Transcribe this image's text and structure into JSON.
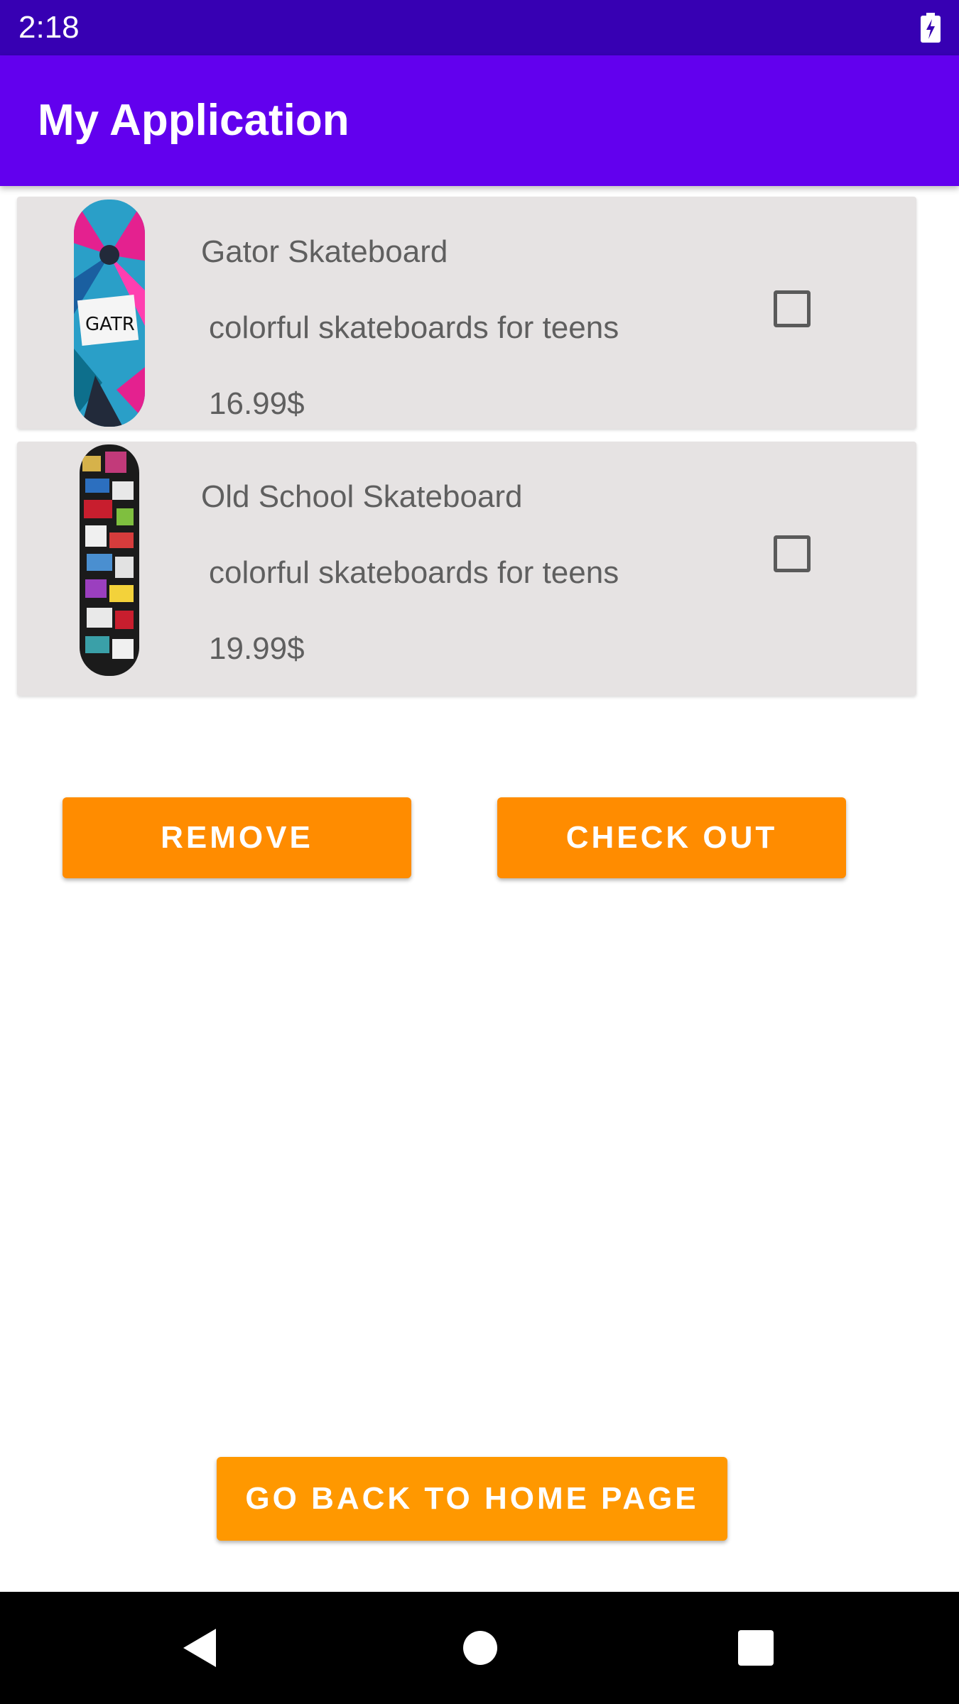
{
  "status_bar": {
    "time": "2:18",
    "battery_icon": "battery-charging-icon"
  },
  "app_bar": {
    "title": "My Application"
  },
  "cart": {
    "items": [
      {
        "name": "Gator Skateboard",
        "description": "colorful skateboards for teens",
        "price": "16.99$",
        "checked": false,
        "image": "gator-skateboard-image"
      },
      {
        "name": "Old School Skateboard",
        "description": "colorful skateboards for teens",
        "price": "19.99$",
        "checked": false,
        "image": "old-school-skateboard-image"
      }
    ]
  },
  "actions": {
    "remove_label": "REMOVE",
    "checkout_label": "CHECK OUT",
    "home_label": "GO BACK TO HOME PAGE"
  },
  "nav_bar": {
    "icons": [
      "back-icon",
      "home-icon",
      "recents-icon"
    ]
  },
  "colors": {
    "status_bar": "#3700b3",
    "app_bar": "#6200ee",
    "button": "#ff8c00",
    "card": "#e6e3e3"
  }
}
